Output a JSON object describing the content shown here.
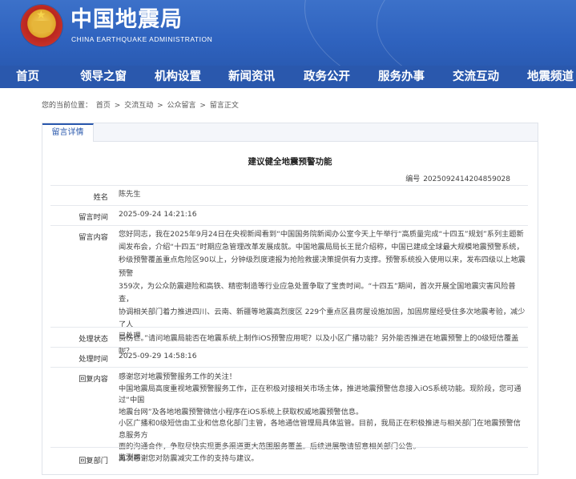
{
  "header": {
    "title": "中国地震局",
    "subtitle": "CHINA EARTHQUAKE ADMINISTRATION"
  },
  "nav": {
    "items": [
      "首页",
      "领导之窗",
      "机构设置",
      "新闻资讯",
      "政务公开",
      "服务办事",
      "交流互动",
      "地震频道"
    ]
  },
  "breadcrumb": {
    "prefix": "您的当前位置：",
    "items": [
      "首页",
      "交流互动",
      "公众留言",
      "留言正文"
    ],
    "separator": ">"
  },
  "panel": {
    "tab": "留言详情",
    "title": "建议健全地震预警功能",
    "number_label": "编号",
    "number": "2025092414204859028",
    "rows": {
      "name_label": "姓名",
      "name": "陈先生",
      "msg_time_label": "留言时间",
      "msg_time": "2025-09-24 14:21:16",
      "content_label": "留言内容",
      "content_lines": [
        "您好同志，我在2025年9月24日在央视新闻看到“中国国务院新闻办公室今天上午举行“高质量完成“十四五”规划”系列主题新",
        "闻发布会，介绍“十四五”时期应急管理改革发展成就。中国地震局局长王昆介绍称，中国已建成全球最大规模地震预警系统，",
        "秒级预警覆盖重点危险区90以上，分钟级烈度速报为抢险救援决策提供有力支撑。预警系统投入使用以来，发布四级以上地震预警",
        "359次，为公众防震避险和高铁、精密制造等行业应急处置争取了宝贵时间。“十四五”期间，首次开展全国地震灾害风险普查，",
        "协调相关部门着力推进四川、云南、新疆等地震高烈度区 229个重点区县房屋设施加固，加固房屋经受住多次地震考验，减少了人",
        "员伤亡。”请问地震局能否在地震系统上制作iOS预警应用呢？以及小区广播功能？另外能否推进在地震预警上的0级短信覆盖",
        "呢？"
      ],
      "status_label": "处理状态",
      "status": "已处理",
      "handle_time_label": "处理时间",
      "handle_time": "2025-09-29 14:58:16",
      "reply_label": "回复内容",
      "reply_lines": [
        "感谢您对地震预警服务工作的关注！",
        "中国地震局高度重视地震预警服务工作，正在积极对接相关市场主体，推进地震预警信息接入iOS系统功能。现阶段，您可通过“中国",
        "地震台网”及各地地震预警微信小程序在iOS系统上获取权威地震预警信息。",
        "小区广播和0级短信由工业和信息化部门主管，各地通信管理局具体监管。目前，我局正在积极推进与相关部门在地震预警信息服务方",
        "面的沟通合作，争取尽快实现更多渠道更大范围服务覆盖。后续进展敬请留意相关部门公告。",
        "再次感谢您对防震减灾工作的支持与建议。"
      ],
      "dept_label": "回复部门",
      "dept": "监测司"
    }
  }
}
